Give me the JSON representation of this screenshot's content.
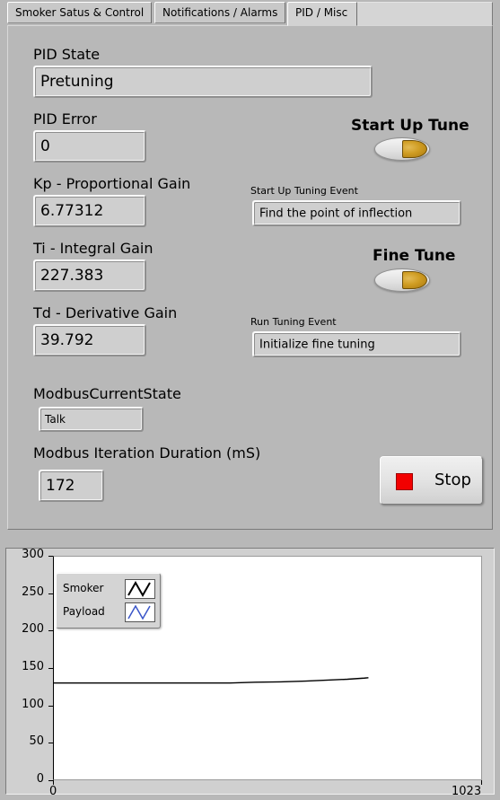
{
  "tabs": [
    {
      "label": "Smoker Satus & Control",
      "active": false
    },
    {
      "label": "Notifications / Alarms",
      "active": false
    },
    {
      "label": "PID / Misc",
      "active": true
    }
  ],
  "fields": {
    "pid_state_label": "PID State",
    "pid_state_value": "Pretuning",
    "pid_error_label": "PID Error",
    "pid_error_value": "0",
    "kp_label": "Kp - Proportional Gain",
    "kp_value": "6.77312",
    "ti_label": "Ti - Integral Gain",
    "ti_value": "227.383",
    "td_label": "Td - Derivative Gain",
    "td_value": "39.792",
    "modbus_state_label": "ModbusCurrentState",
    "modbus_state_value": "Talk",
    "modbus_duration_label": "Modbus Iteration Duration (mS)",
    "modbus_duration_value": "172"
  },
  "controls": {
    "startup_tune_label": "Start Up Tune",
    "startup_tuning_event_label": "Start Up Tuning Event",
    "startup_tuning_event_value": "Find the point of inflection",
    "fine_tune_label": "Fine Tune",
    "run_tuning_event_label": "Run Tuning Event",
    "run_tuning_event_value": "Initialize fine tuning",
    "stop_label": "Stop",
    "stop_color": "#f20000",
    "switch_knob_color": "#cf9c22"
  },
  "chart_data": {
    "type": "line",
    "title": "",
    "xlabel": "",
    "ylabel": "",
    "xlim": [
      0,
      1023
    ],
    "ylim": [
      0,
      300
    ],
    "yticks": [
      300,
      250,
      200,
      150,
      100,
      50,
      0
    ],
    "xticks": [
      0,
      1023
    ],
    "grid": false,
    "legend_position": "top-left",
    "series": [
      {
        "name": "Smoker",
        "color": "#000000",
        "x": [
          0,
          60,
          120,
          180,
          240,
          300,
          360,
          420,
          480,
          540,
          600,
          660,
          700,
          740,
          750
        ],
        "values": [
          130,
          130,
          130,
          130,
          130,
          130,
          130,
          130,
          131,
          131.5,
          132.5,
          134,
          135,
          136.5,
          137
        ]
      },
      {
        "name": "Payload",
        "color": "#3a55c8",
        "x": [],
        "values": []
      }
    ]
  }
}
